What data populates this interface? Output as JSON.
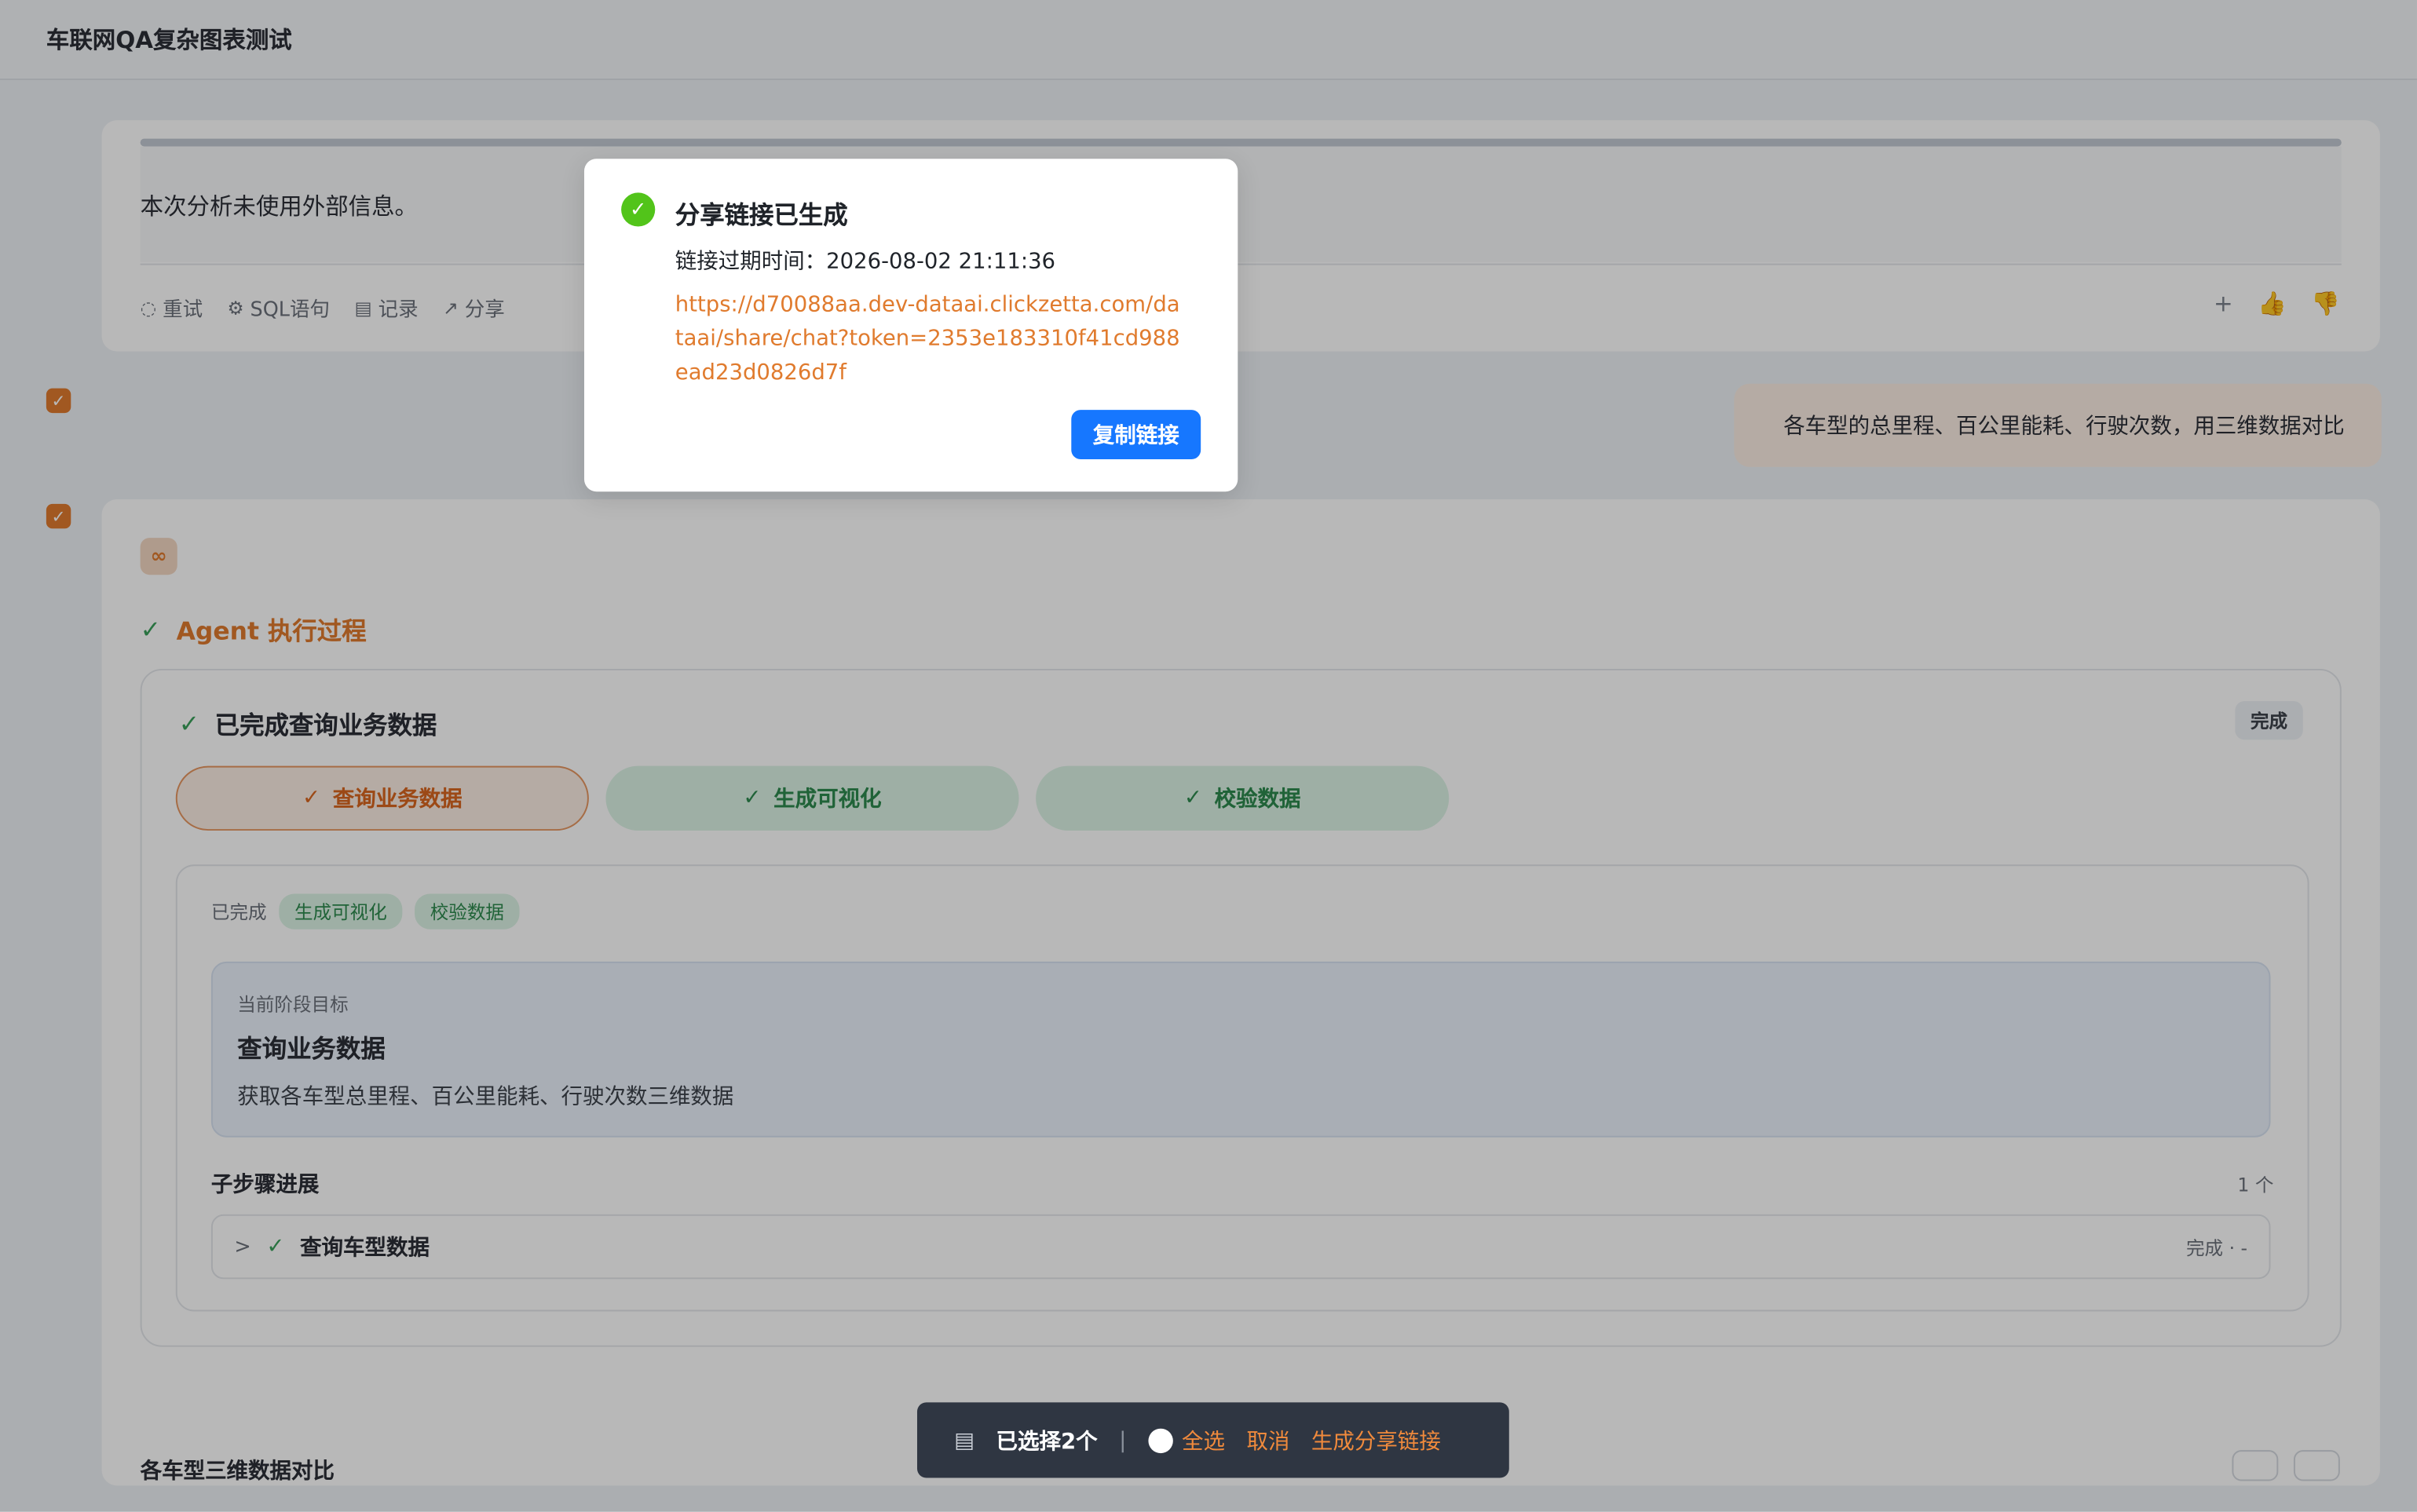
{
  "header": {
    "title": "车联网QA复杂图表测试"
  },
  "prev_message": {
    "note": "本次分析未使用外部信息。",
    "actions": [
      {
        "icon": "bulb-icon",
        "label": "重试"
      },
      {
        "icon": "sql-icon",
        "label": "SQL语句"
      },
      {
        "icon": "record-icon",
        "label": "记录"
      },
      {
        "icon": "share-icon",
        "label": "分享"
      }
    ],
    "right_icons": [
      "plus-icon",
      "thumbs-up-icon",
      "thumbs-down-icon"
    ],
    "right_icon_glyphs": {
      "plus": "+",
      "up": "👍",
      "down": "👎"
    }
  },
  "user_message": {
    "text": "各车型的总里程、百公里能耗、行驶次数，用三维数据对比"
  },
  "agent": {
    "title": "Agent 执行过程",
    "box_title": "已完成查询业务数据",
    "status_badge": "完成",
    "steps": [
      {
        "label": "查询业务数据",
        "state": "active"
      },
      {
        "label": "生成可视化",
        "state": "done"
      },
      {
        "label": "校验数据",
        "state": "done"
      }
    ],
    "completed_label": "已完成",
    "completed_tags": [
      "生成可视化",
      "校验数据"
    ],
    "goal": {
      "label": "当前阶段目标",
      "heading": "查询业务数据",
      "desc": "获取各车型总里程、百公里能耗、行驶次数三维数据"
    },
    "substeps": {
      "title": "子步骤进展",
      "count": "1 个",
      "items": [
        {
          "label": "查询车型数据",
          "status": "完成 · -"
        }
      ]
    },
    "cut_text": "各车型三维数据对比"
  },
  "selection_bar": {
    "count_label": "已选择2个",
    "separator": "|",
    "select_all": "全选",
    "cancel": "取消",
    "generate": "生成分享链接"
  },
  "share_modal": {
    "title": "分享链接已生成",
    "expire": "链接过期时间：2026-08-02 21:11:36",
    "url": "https://d70088aa.dev-dataai.clickzetta.com/dataai/share/chat?token=2353e183310f41cd988ead23d0826d7f",
    "copy_button": "复制链接"
  }
}
